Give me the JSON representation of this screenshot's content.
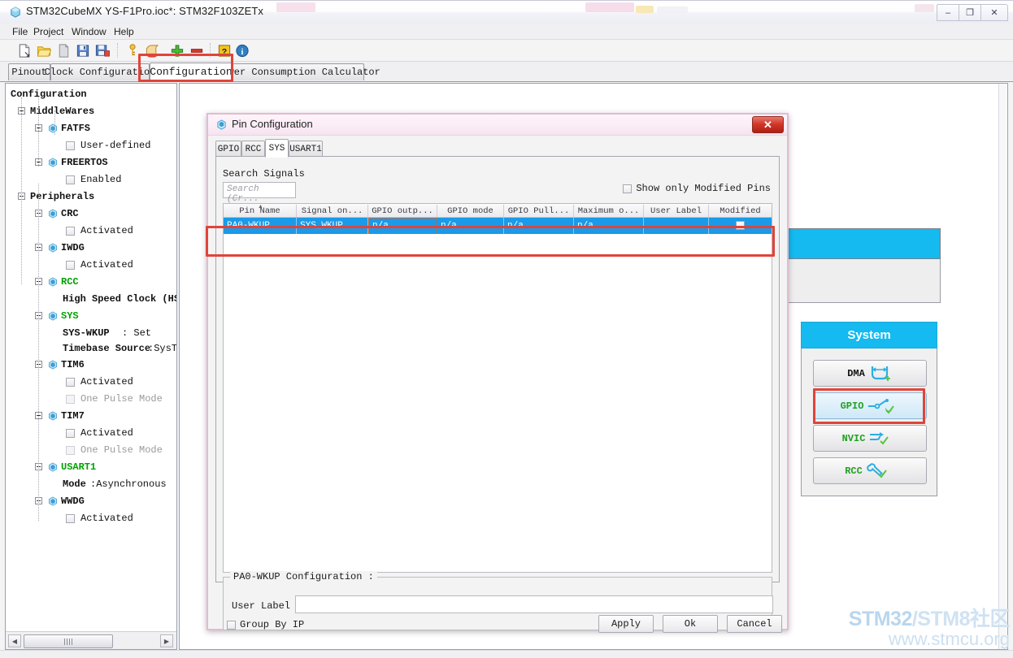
{
  "window": {
    "title": "STM32CubeMX YS-F1Pro.ioc*: STM32F103ZETx",
    "app_icon": "cube-icon",
    "controls": {
      "minimize": "–",
      "maximize": "❐",
      "close": "✕"
    }
  },
  "menubar": {
    "items": [
      "File",
      "Project",
      "Window",
      "Help"
    ]
  },
  "toolbar": {
    "items": [
      "new-file-icon",
      "open-folder-icon",
      "copy-page-icon",
      "save-icon",
      "save-as-icon",
      "key-icon",
      "scroll-generate-icon",
      "add-plus-icon",
      "remove-minus-icon",
      "help-question-icon",
      "about-info-icon"
    ]
  },
  "main_tabs": {
    "items": [
      "Pinout",
      "Clock Configuration",
      "Configuration",
      "Power Consumption Calculator"
    ],
    "active": "Configuration"
  },
  "sidebar": {
    "root_label": "Configuration",
    "groups": [
      {
        "label": "MiddleWares",
        "peripherals": [
          {
            "label": "FATFS",
            "state": "off",
            "children": [
              {
                "label": "User-defined",
                "type": "checkbox",
                "checked": false,
                "dim": false
              }
            ]
          },
          {
            "label": "FREERTOS",
            "state": "off",
            "children": [
              {
                "label": "Enabled",
                "type": "checkbox",
                "checked": false,
                "dim": false
              }
            ]
          }
        ]
      },
      {
        "label": "Peripherals",
        "peripherals": [
          {
            "label": "CRC",
            "state": "off",
            "children": [
              {
                "label": "Activated",
                "type": "checkbox",
                "checked": false,
                "dim": false
              }
            ]
          },
          {
            "label": "IWDG",
            "state": "off",
            "children": [
              {
                "label": "Activated",
                "type": "checkbox",
                "checked": false,
                "dim": false
              }
            ]
          },
          {
            "label": "RCC",
            "state": "on",
            "children": [
              {
                "label": "High Speed Clock (HS",
                "type": "text",
                "clipped": true
              }
            ]
          },
          {
            "label": "SYS",
            "state": "on",
            "children": [
              {
                "label": "SYS-WKUP",
                "value": ": Set",
                "type": "kv"
              },
              {
                "label": "Timebase Source",
                "value": ":SysTi",
                "type": "kv",
                "clipped": true
              }
            ]
          },
          {
            "label": "TIM6",
            "state": "off",
            "children": [
              {
                "label": "Activated",
                "type": "checkbox",
                "checked": false,
                "dim": false
              },
              {
                "label": "One Pulse Mode",
                "type": "checkbox",
                "checked": false,
                "dim": true
              }
            ]
          },
          {
            "label": "TIM7",
            "state": "off",
            "children": [
              {
                "label": "Activated",
                "type": "checkbox",
                "checked": false,
                "dim": false
              },
              {
                "label": "One Pulse Mode",
                "type": "checkbox",
                "checked": false,
                "dim": true
              }
            ]
          },
          {
            "label": "USART1",
            "state": "on",
            "children": [
              {
                "label": "Mode",
                "value": ":Asynchronous",
                "type": "kv"
              }
            ]
          },
          {
            "label": "WWDG",
            "state": "off",
            "children": [
              {
                "label": "Activated",
                "type": "checkbox",
                "checked": false,
                "dim": false
              }
            ]
          }
        ]
      }
    ],
    "hscroll": {
      "left_arrow": "◀",
      "right_arrow": "▶"
    }
  },
  "canvas": {
    "background_panel": {
      "title": ""
    },
    "system_panel": {
      "title": "System",
      "buttons": [
        {
          "label": "DMA",
          "icon": "dma-icon",
          "color": "black",
          "selected": false
        },
        {
          "label": "GPIO",
          "icon": "gpio-icon",
          "color": "green",
          "selected": true
        },
        {
          "label": "NVIC",
          "icon": "nvic-icon",
          "color": "green",
          "selected": false
        },
        {
          "label": "RCC",
          "icon": "rcc-wrench-icon",
          "color": "green",
          "selected": false
        }
      ]
    }
  },
  "dialog": {
    "title": "Pin Configuration",
    "title_icon": "cube-icon",
    "close_label": "✕",
    "tabs": {
      "items": [
        "GPIO",
        "RCC",
        "SYS",
        "USART1"
      ],
      "active": "SYS"
    },
    "search": {
      "label": "Search Signals",
      "placeholder": "Search (Cr...",
      "value": ""
    },
    "show_modified": {
      "label": "Show only Modified Pins",
      "checked": false
    },
    "table": {
      "columns": [
        "Pin Name",
        "Signal on...",
        "GPIO outp...",
        "GPIO mode",
        "GPIO Pull...",
        "Maximum o...",
        "User Label",
        "Modified"
      ],
      "sort_indicator": "▲",
      "rows": [
        {
          "selected": true,
          "cells": [
            "PA0-WKUP",
            "SYS_WKUP",
            "n/a",
            "n/a",
            "n/a",
            "n/a",
            ""
          ],
          "modified": false
        }
      ]
    },
    "config_group": {
      "legend": "PA0-WKUP Configuration :",
      "user_label_label": "User Label",
      "user_label_value": ""
    },
    "footer": {
      "group_by_ip": {
        "label": "Group By IP",
        "checked": false
      },
      "buttons": [
        "Apply",
        "Ok",
        "Cancel"
      ]
    }
  },
  "annotations": {
    "highlight_color": "#e0443a",
    "boxes": [
      "configuration-tab-highlight",
      "pin-row-highlight",
      "gpio-button-highlight"
    ]
  },
  "watermark": {
    "line1_a": "STM32",
    "line1_b": "/STM8",
    "line1_c": "社区",
    "line2": "www.stmcu.org"
  }
}
